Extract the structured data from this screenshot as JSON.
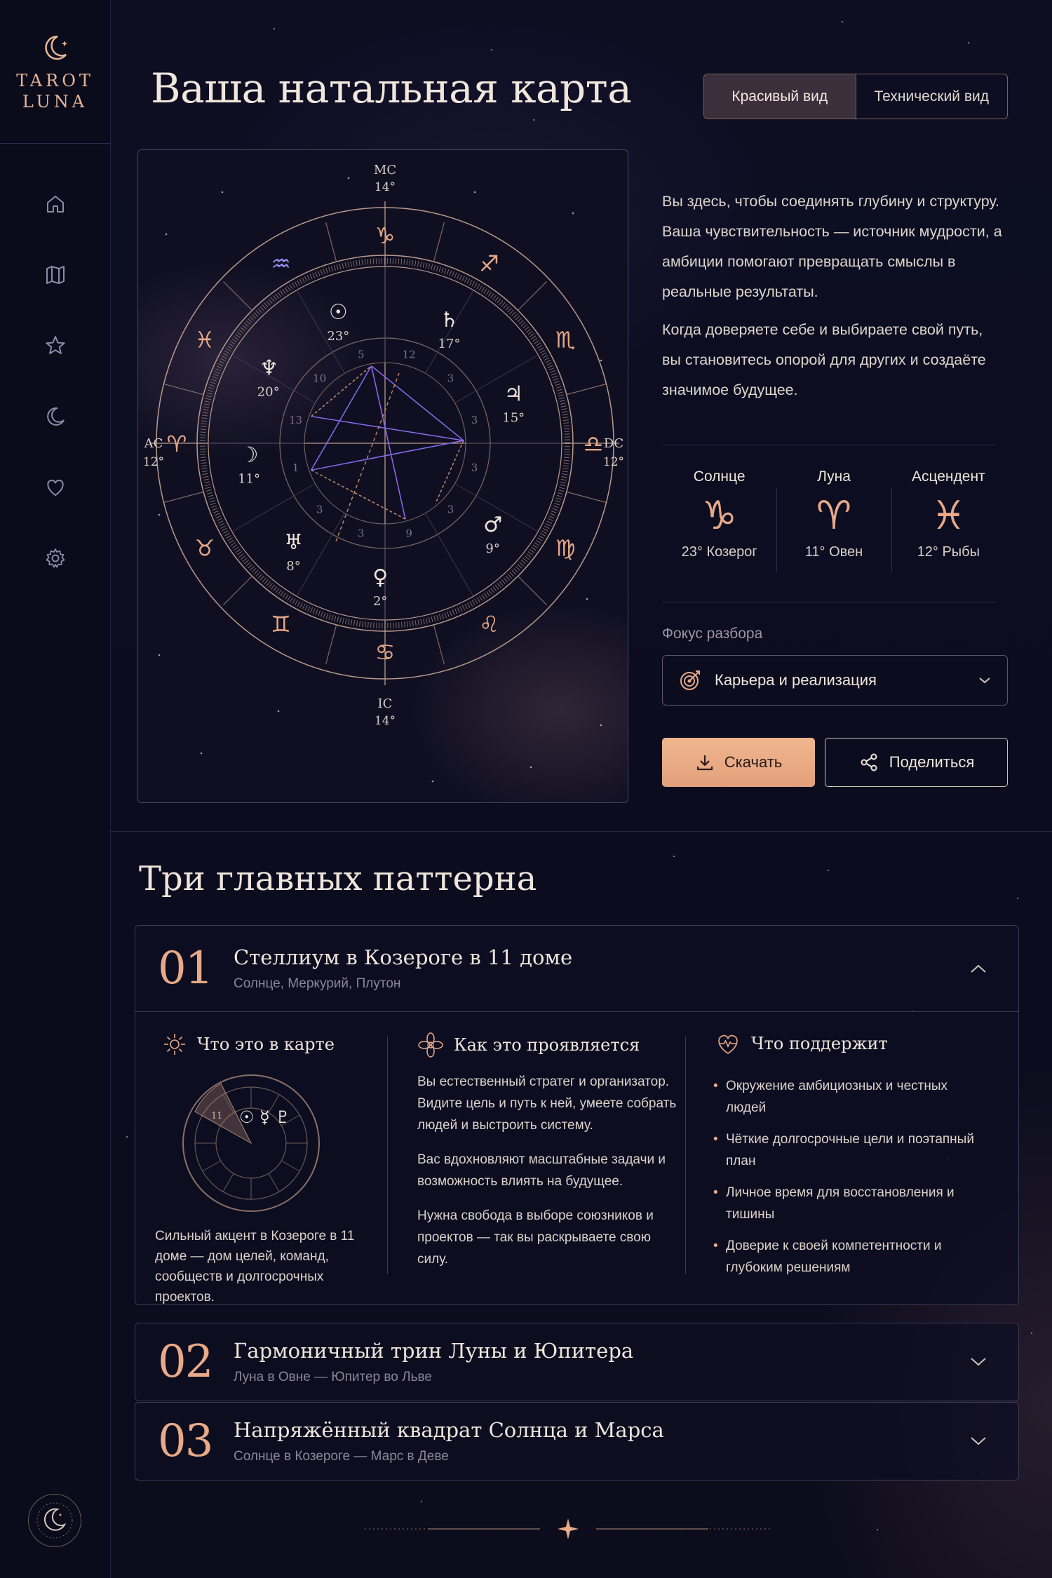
{
  "brand": {
    "name_line1": "TAROT",
    "name_line2": "LUNA"
  },
  "page": {
    "title": "Ваша натальная карта"
  },
  "view_toggle": {
    "active": "Красивый вид",
    "inactive": "Технический вид"
  },
  "sidebar": {
    "items": [
      {
        "icon": "home-icon"
      },
      {
        "icon": "map-icon"
      },
      {
        "icon": "star-icon"
      },
      {
        "icon": "moon-icon"
      },
      {
        "icon": "heart-icon"
      },
      {
        "icon": "gear-icon"
      }
    ]
  },
  "chart": {
    "mc_label": "MC",
    "mc_deg": "14°",
    "ic_label": "IC",
    "ic_deg": "14°",
    "ac_label": "AC",
    "ac_deg": "12°",
    "dc_label": "DC",
    "dc_deg": "12°",
    "signs": [
      "♑",
      "♐",
      "♏",
      "♎",
      "♍",
      "♌",
      "♋",
      "♊",
      "♉",
      "♈",
      "♓",
      "♒"
    ],
    "planets": [
      {
        "glyph": "☉",
        "deg": "23°"
      },
      {
        "glyph": "♄",
        "deg": "17°"
      },
      {
        "glyph": "♃",
        "deg": "15°"
      },
      {
        "glyph": "♆",
        "deg": "20°"
      },
      {
        "glyph": "☽",
        "deg": "11°"
      },
      {
        "glyph": "♅",
        "deg": "8°"
      },
      {
        "glyph": "♀",
        "deg": "2°"
      },
      {
        "glyph": "♂",
        "deg": "9°"
      }
    ],
    "houses": [
      "12",
      "3",
      "3",
      "3",
      "3",
      "9",
      "3",
      "3",
      "1",
      "13",
      "10",
      "5"
    ]
  },
  "intro": {
    "p1": "Вы здесь, чтобы соединять глубину и структуру. Ваша чувствительность — источник мудрости, а амбиции помогают превращать смыслы в реальные результаты.",
    "p2": "Когда доверяете себе и выбираете свой путь, вы становитесь опорой для других и создаёте значимое будущее."
  },
  "big_three": [
    {
      "label": "Солнце",
      "glyph": "♑",
      "value": "23° Козерог"
    },
    {
      "label": "Луна",
      "glyph": "♈",
      "value": "11° Овен"
    },
    {
      "label": "Асцендент",
      "glyph": "♓",
      "value": "12° Рыбы"
    }
  ],
  "focus": {
    "label": "Фокус разбора",
    "value": "Карьера и реализация"
  },
  "actions": {
    "download": "Скачать",
    "share": "Поделиться"
  },
  "patterns": {
    "title": "Три главных паттерна",
    "items": [
      {
        "num": "01",
        "title": "Стеллиум в Козероге в 11 доме",
        "sub": "Солнце, Меркурий, Плутон",
        "col1_title": "Что это в карте",
        "col1_text": "Сильный акцент в Козероге в 11 доме — дом целей, команд, сообществ и долгосрочных проектов.",
        "mini_house": "11",
        "mini_glyphs": "☉ ☿ ♇",
        "col2_title": "Как это проявляется",
        "col2_p1": "Вы естественный стратег и организатор. Видите цель и путь к ней, умеете собрать людей и выстроить систему.",
        "col2_p2": "Вас вдохновляют масштабные задачи и возможность влиять на будущее.",
        "col2_p3": "Нужна свобода в выборе союзников и проектов — так вы раскрываете свою силу.",
        "col3_title": "Что поддержит",
        "col3_items": [
          "Окружение амбициозных и честных людей",
          "Чёткие долгосрочные цели и поэтапный план",
          "Личное время для восстановления и тишины",
          "Доверие к своей компетентности и глубоким решениям"
        ]
      },
      {
        "num": "02",
        "title": "Гармоничный трин Луны и Юпитера",
        "sub": "Луна в Овне — Юпитер во Льве"
      },
      {
        "num": "03",
        "title": "Напряжённый квадрат Солнца и Марса",
        "sub": "Солнце в Козероге — Марс в Деве"
      }
    ]
  },
  "colors": {
    "accent": "#e7a987",
    "bg": "#0c0d1f",
    "line_purple": "#8a6cf0"
  }
}
